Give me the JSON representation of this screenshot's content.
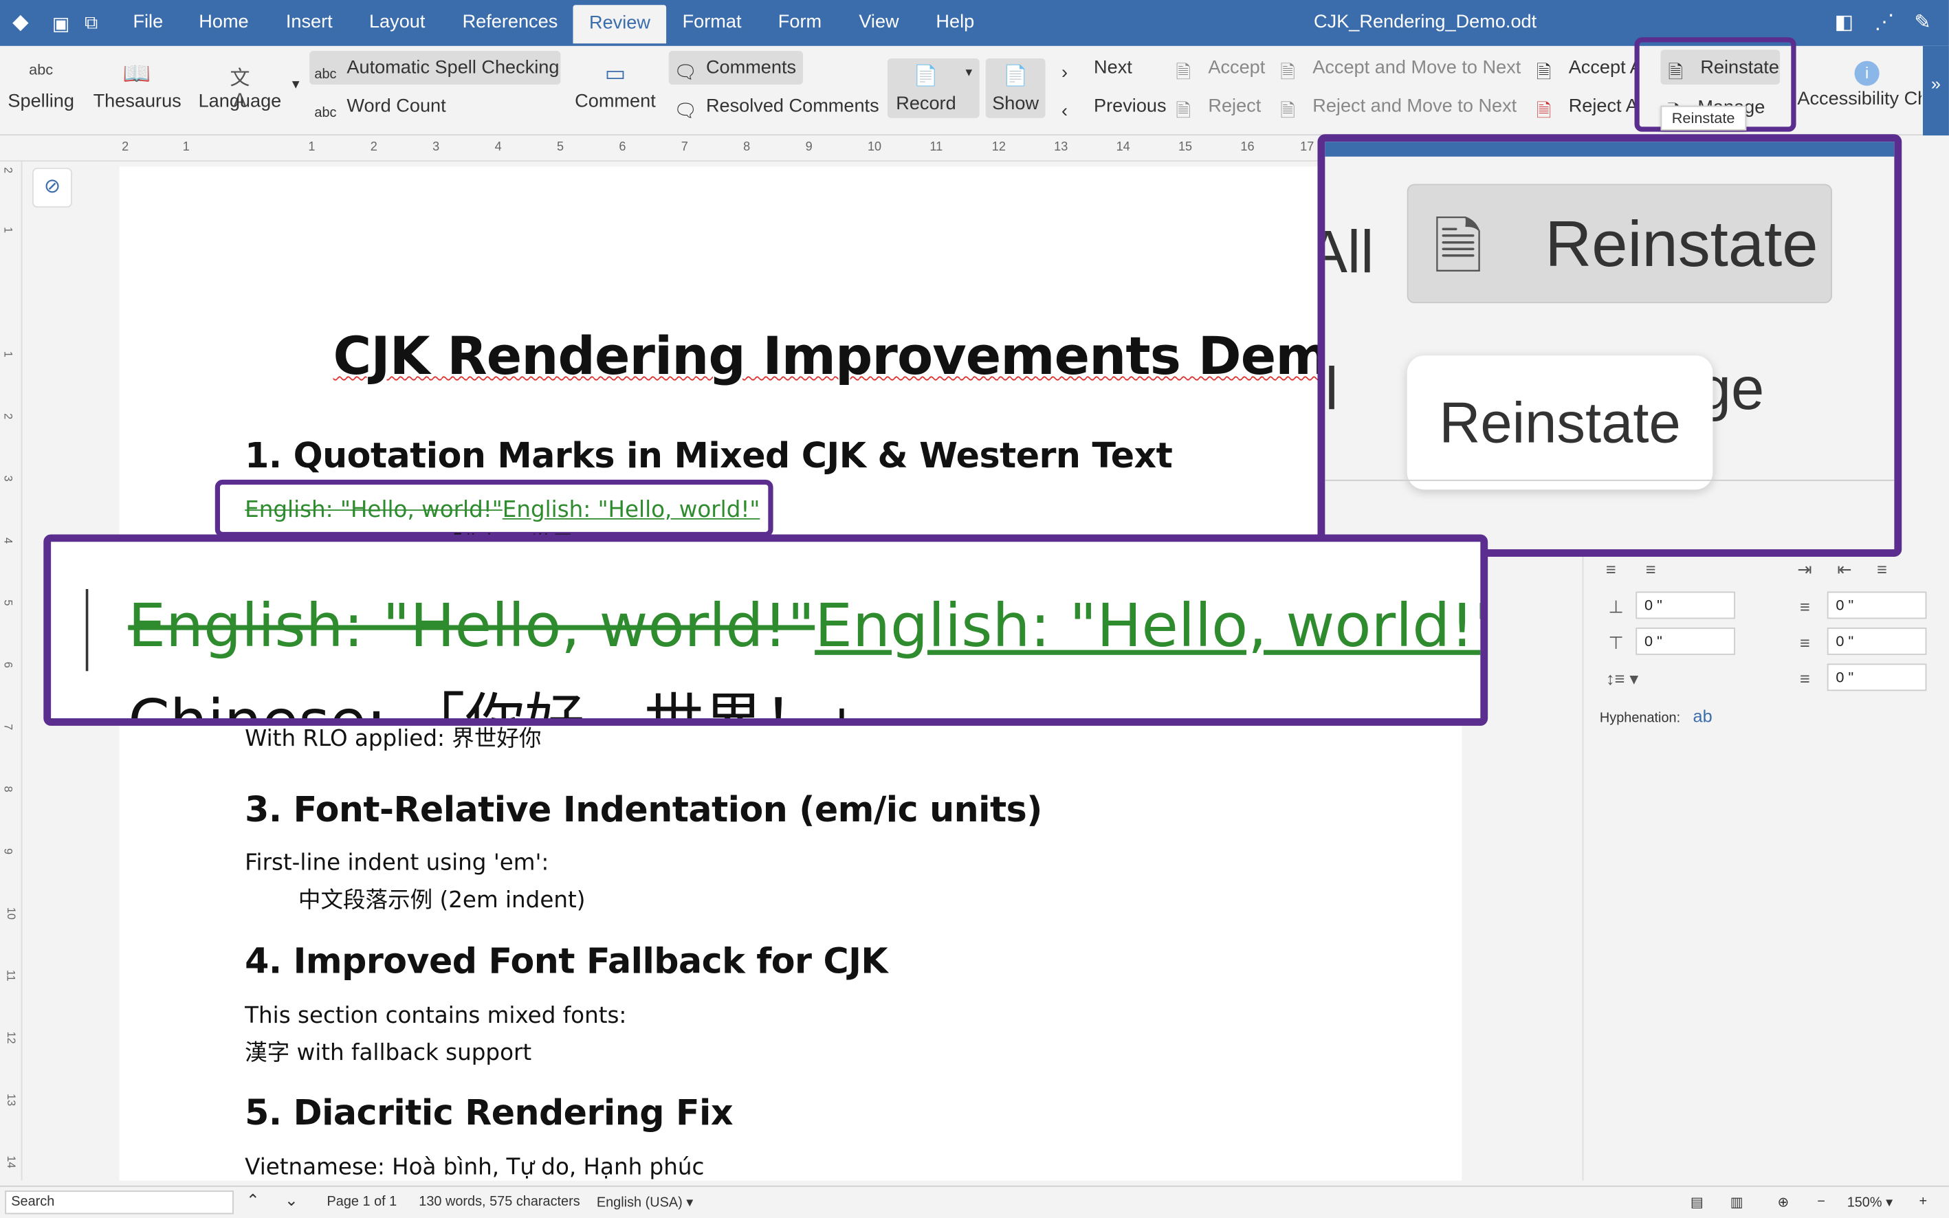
{
  "window": {
    "title": "CJK_Rendering_Demo.odt"
  },
  "menu": {
    "file": "File",
    "home": "Home",
    "insert": "Insert",
    "layout": "Layout",
    "references": "References",
    "review": "Review",
    "format": "Format",
    "form": "Form",
    "view": "View",
    "help": "Help"
  },
  "ribbon": {
    "spelling": "Spelling",
    "spelling_icon_text": "abc",
    "thesaurus": "Thesaurus",
    "language": "Language",
    "auto_spell": "Automatic Spell Checking",
    "word_count": "Word Count",
    "comment": "Comment",
    "comments": "Comments",
    "resolved_comments": "Resolved Comments",
    "record": "Record",
    "show": "Show",
    "next": "Next",
    "previous": "Previous",
    "accept": "Accept",
    "reject": "Reject",
    "accept_move_next": "Accept and Move to Next",
    "reject_move_next": "Reject and Move to Next",
    "accept_all": "Accept All",
    "reject_all": "Reject All",
    "reinstate": "Reinstate",
    "manage": "Manage",
    "accessibility": "Accessibility Check"
  },
  "tooltip": {
    "reinstate": "Reinstate"
  },
  "ruler_h": [
    "2",
    "1",
    "1",
    "2",
    "3",
    "4",
    "5",
    "6",
    "7",
    "8",
    "9",
    "10",
    "11",
    "12",
    "13",
    "14",
    "15",
    "16",
    "17"
  ],
  "ruler_v": [
    "2",
    "1",
    "1",
    "2",
    "3",
    "4",
    "5",
    "6",
    "7",
    "8",
    "9",
    "10",
    "11",
    "12",
    "13",
    "14"
  ],
  "document": {
    "title": "CJK Rendering Improvements Demo",
    "h1": "1. Quotation Marks in Mixed CJK & Western Text",
    "deleted_text": "English: \"Hello, world!\"",
    "inserted_text": "English: \"Hello, world!\"",
    "chinese_partial": "Chinese: 「你好，世界！」",
    "rlo_line": "With RLO applied: 界世好你",
    "h3": "3. Font-Relative Indentation (em/ic units)",
    "h3_p1": "First-line indent using 'em':",
    "h3_p2": "中文段落示例 (2em indent)",
    "h4": "4. Improved Font Fallback for CJK",
    "h4_p1": "This section contains mixed fonts:",
    "h4_p2": "漢字 with fallback support",
    "h5": "5. Diacritic Rendering Fix",
    "h5_p1": "Vietnamese: Hoà bình, Tự do, Hạnh phúc"
  },
  "sidebar": {
    "hyphenation": "Hyphenation:",
    "spin_values": [
      "0",
      "0",
      "0",
      "0",
      "0"
    ],
    "spin_unit": "\""
  },
  "zoom_callout": {
    "reinstate": "Reinstate",
    "tooltip": "Reinstate",
    "left_fragment": "All",
    "right_fragment": "ge"
  },
  "text_callout": {
    "deleted": "English: \"Hello, world!\"",
    "inserted": "English: \"Hello, world!\"",
    "chinese": "Chinese: 「你好，世界！」"
  },
  "status": {
    "search_placeholder": "Search",
    "page": "Page 1 of 1",
    "counts": "130 words, 575 characters",
    "language": "English (USA)",
    "zoom": "150%"
  },
  "colors": {
    "accent": "#3b6dad",
    "tracked_change": "#2e8b2e",
    "callout_border": "#5a2d8f"
  }
}
